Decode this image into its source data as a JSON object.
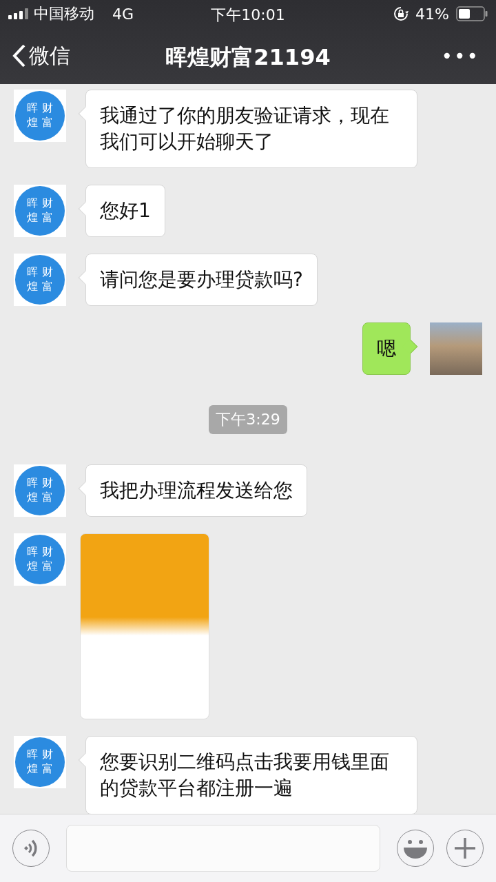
{
  "status_bar": {
    "carrier": "中国移动",
    "network": "4G",
    "time": "下午10:01",
    "battery": "41%"
  },
  "nav": {
    "back_label": "微信",
    "title": "晖煌财富21194",
    "more": "•••"
  },
  "messages": [
    {
      "kind": "text",
      "outgoing": false,
      "avatar_lines": [
        "晖 财",
        "煌 富"
      ],
      "text": "我通过了你的朋友验证请求，现在我们可以开始聊天了"
    },
    {
      "kind": "text",
      "outgoing": false,
      "avatar_lines": [
        "晖 财",
        "煌 富"
      ],
      "text": "您好1"
    },
    {
      "kind": "text",
      "outgoing": false,
      "avatar_lines": [
        "晖 财",
        "煌 富"
      ],
      "text": "请问您是要办理贷款吗?"
    },
    {
      "kind": "text",
      "outgoing": true,
      "text": "嗯"
    },
    {
      "kind": "time",
      "text": "下午3:29"
    },
    {
      "kind": "text",
      "outgoing": false,
      "avatar_lines": [
        "晖 财",
        "煌 富"
      ],
      "text": "我把办理流程发送给您"
    },
    {
      "kind": "image",
      "avatar_lines": [
        "晖 财",
        "煌 富"
      ]
    },
    {
      "kind": "text",
      "outgoing": false,
      "avatar_lines": [
        "晖 财",
        "煌 富"
      ],
      "text": "您要识别二维码点击我要用钱里面的贷款平台都注册一遍"
    }
  ]
}
